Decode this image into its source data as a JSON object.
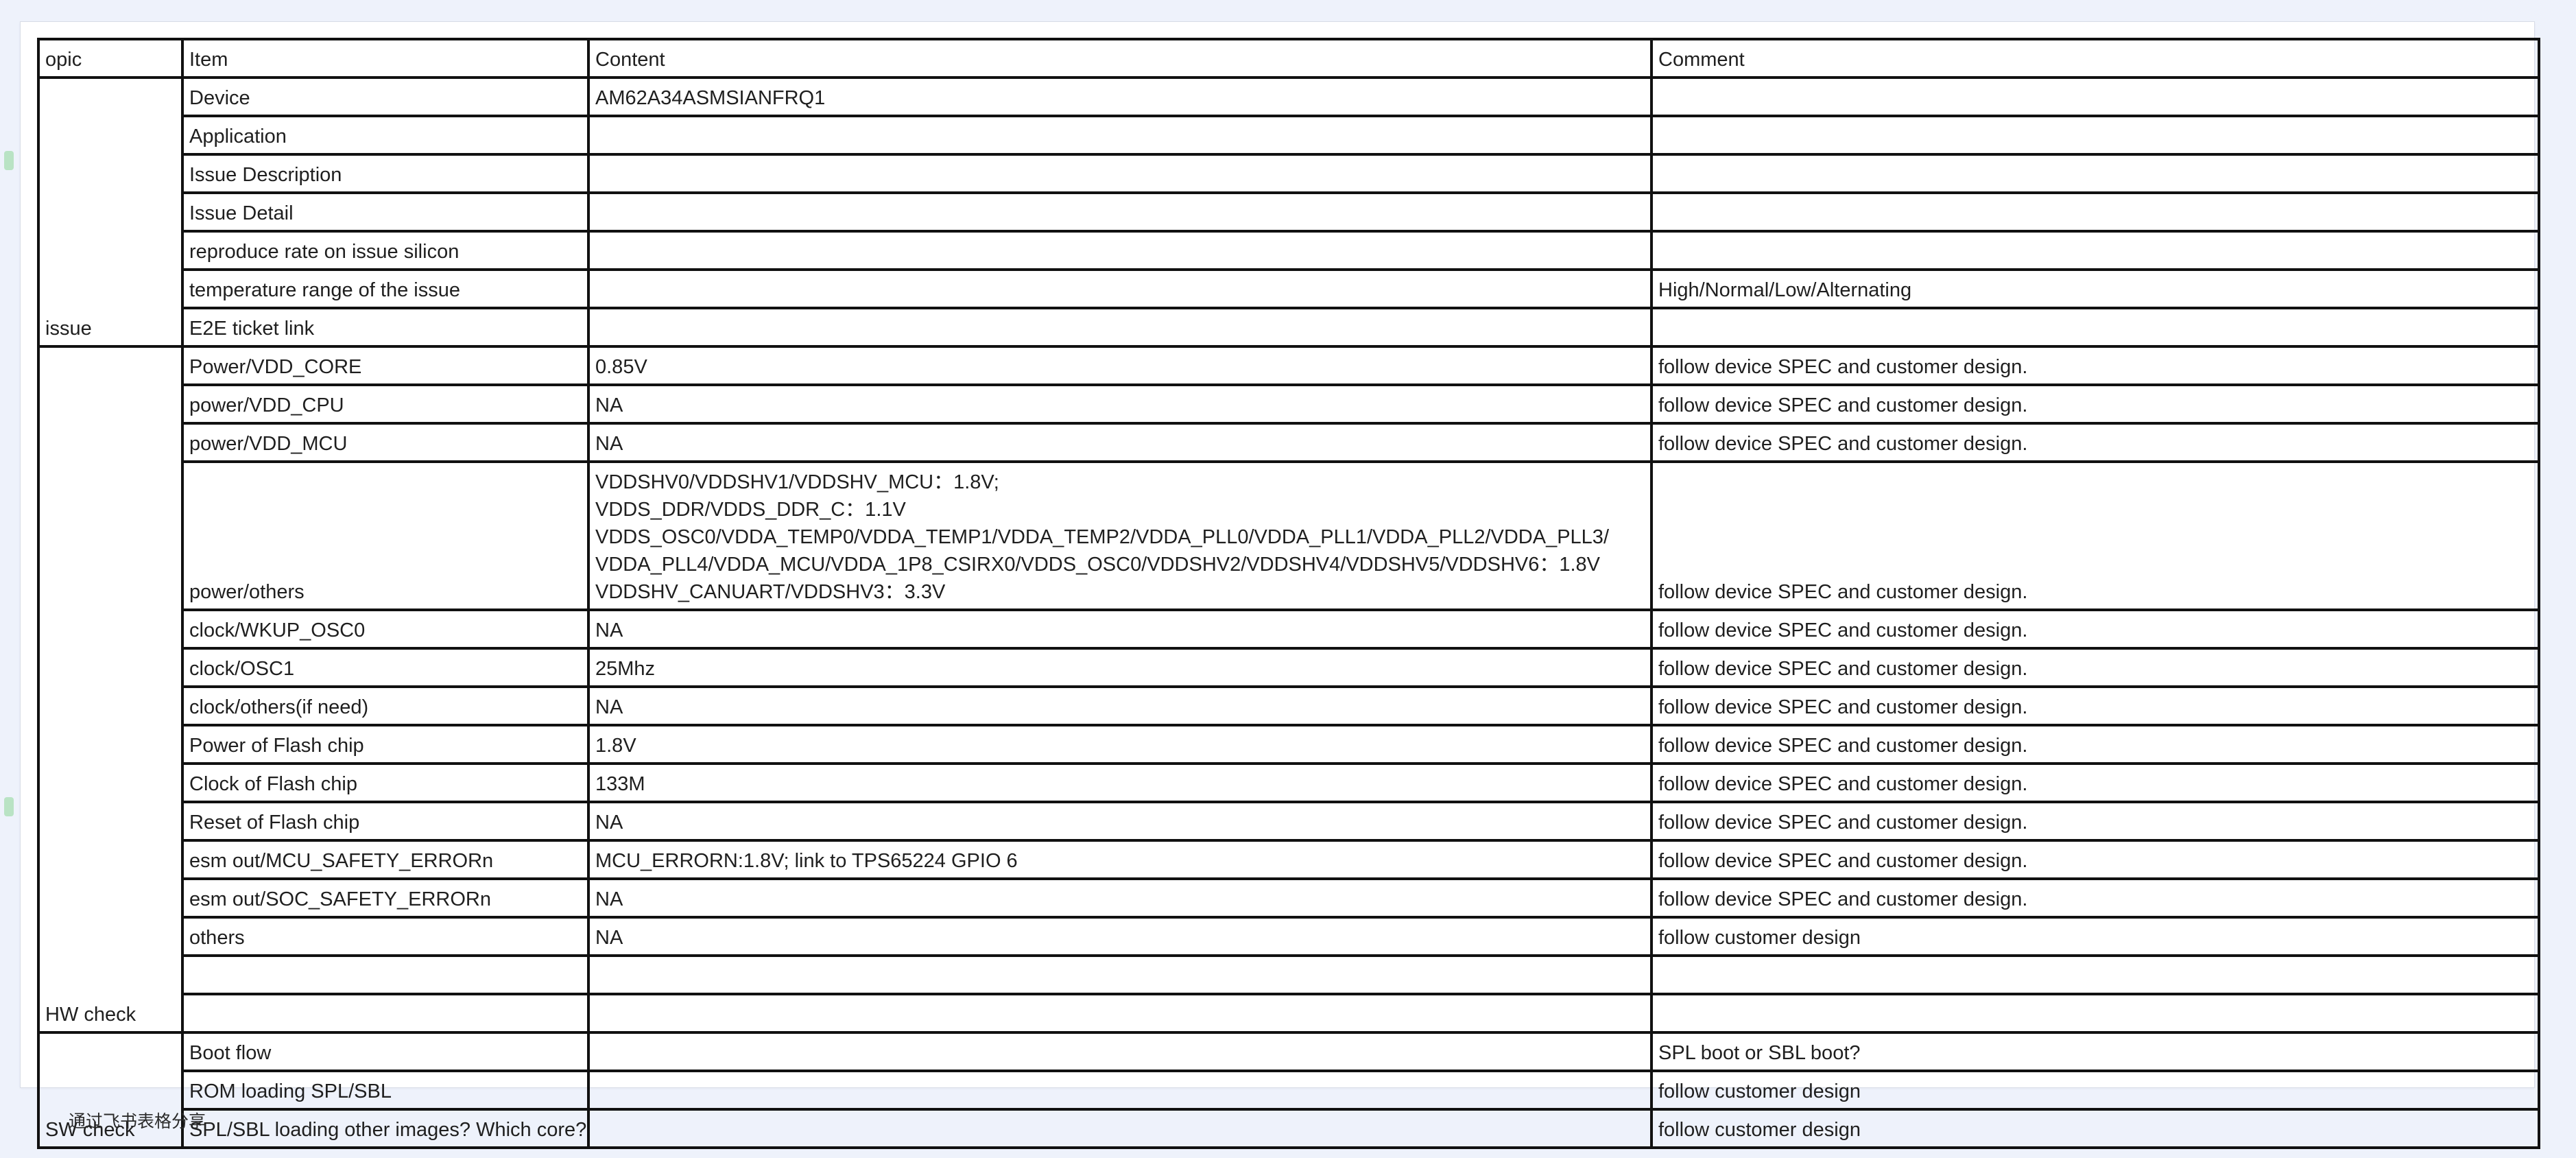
{
  "table": {
    "headers": [
      "opic",
      "Item",
      "Content",
      "Comment"
    ],
    "groups": [
      {
        "topic": "issue",
        "rows": [
          {
            "item": "Device",
            "content": "AM62A34ASMSIANFRQ1",
            "comment": ""
          },
          {
            "item": "Application",
            "content": "",
            "comment": ""
          },
          {
            "item": "Issue Description",
            "content": "",
            "comment": ""
          },
          {
            "item": "Issue Detail",
            "content": "",
            "comment": ""
          },
          {
            "item": "reproduce rate on issue silicon",
            "content": "",
            "comment": ""
          },
          {
            "item": "temperature range of the issue",
            "content": "",
            "comment": "High/Normal/Low/Alternating"
          },
          {
            "item": "E2E ticket link",
            "content": "",
            "comment": ""
          }
        ]
      },
      {
        "topic": "HW check",
        "rows": [
          {
            "item": "Power/VDD_CORE",
            "content": "0.85V",
            "comment": "follow device SPEC and customer design."
          },
          {
            "item": "power/VDD_CPU",
            "content": "NA",
            "comment": "follow device SPEC and customer design."
          },
          {
            "item": "power/VDD_MCU",
            "content": "NA",
            "comment": "follow device SPEC and customer design."
          },
          {
            "item": "power/others",
            "content_lines": [
              "VDDSHV0/VDDSHV1/VDDSHV_MCU：1.8V;",
              "VDDS_DDR/VDDS_DDR_C：1.1V",
              "VDDS_OSC0/VDDA_TEMP0/VDDA_TEMP1/VDDA_TEMP2/VDDA_PLL0/VDDA_PLL1/VDDA_PLL2/VDDA_PLL3/",
              "VDDA_PLL4/VDDA_MCU/VDDA_1P8_CSIRX0/VDDS_OSC0/VDDSHV2/VDDSHV4/VDDSHV5/VDDSHV6：1.8V",
              "VDDSHV_CANUART/VDDSHV3：3.3V"
            ],
            "comment": "follow device SPEC and customer design."
          },
          {
            "item": "clock/WKUP_OSC0",
            "content": "NA",
            "comment": "follow device SPEC and customer design."
          },
          {
            "item": "clock/OSC1",
            "content": "25Mhz",
            "comment": "follow device SPEC and customer design."
          },
          {
            "item": "clock/others(if need)",
            "content": "NA",
            "comment": "follow device SPEC and customer design."
          },
          {
            "item": "Power of Flash chip",
            "content": "1.8V",
            "comment": "follow device SPEC and customer design."
          },
          {
            "item": "Clock of Flash chip",
            "content": "133M",
            "comment": "follow device SPEC and customer design."
          },
          {
            "item": "Reset of Flash chip",
            "content": "NA",
            "comment": "follow device SPEC and customer design."
          },
          {
            "item": "esm out/MCU_SAFETY_ERRORn",
            "content": "MCU_ERRORN:1.8V; link to TPS65224 GPIO 6",
            "comment": "follow device SPEC and customer design."
          },
          {
            "item": "esm out/SOC_SAFETY_ERRORn",
            "content": "NA",
            "comment": "follow device SPEC and customer design."
          },
          {
            "item": "others",
            "content": "NA",
            "comment": "follow customer design"
          }
        ]
      },
      {
        "topic": "SW check",
        "rows": [
          {
            "item": "Boot flow",
            "content": "",
            "comment": "SPL boot or SBL boot?"
          },
          {
            "item": "ROM loading SPL/SBL",
            "content": "",
            "comment": "follow customer design"
          },
          {
            "item": "SPL/SBL loading other images? Which core?",
            "content": "",
            "comment": "follow customer design"
          }
        ]
      }
    ]
  },
  "footer": {
    "share_text": "通过飞书表格分享"
  },
  "colors": {
    "page_background": "#eef2fb",
    "grid_line": "#111111"
  }
}
